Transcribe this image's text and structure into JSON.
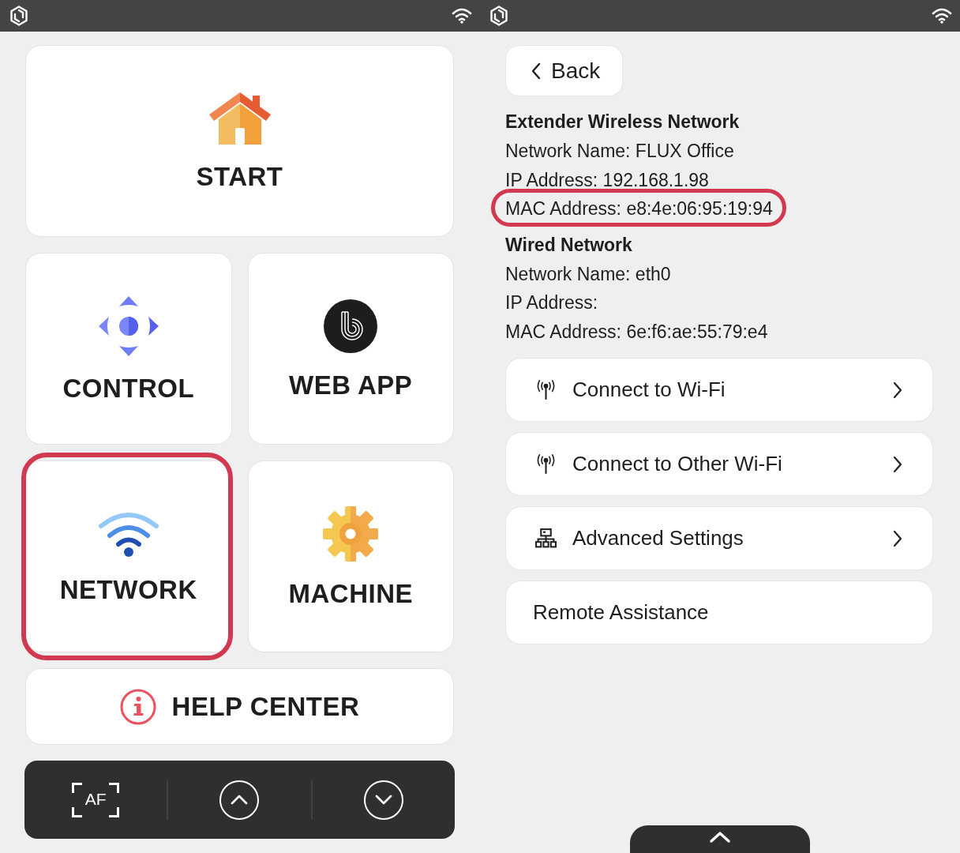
{
  "home_screen": {
    "tiles": [
      {
        "kind": "start",
        "label": "START",
        "highlighted": false
      },
      {
        "kind": "control",
        "label": "CONTROL",
        "highlighted": false
      },
      {
        "kind": "web_app",
        "label": "WEB APP",
        "highlighted": false
      },
      {
        "kind": "network",
        "label": "NETWORK",
        "highlighted": true
      },
      {
        "kind": "machine",
        "label": "MACHINE",
        "highlighted": false
      }
    ],
    "help_button": {
      "label": "HELP CENTER"
    },
    "toolbar": {
      "buttons": [
        {
          "kind": "autofocus",
          "label": "AF"
        },
        {
          "kind": "scroll_up"
        },
        {
          "kind": "scroll_down"
        }
      ]
    }
  },
  "network_screen": {
    "back_button": {
      "label": "Back"
    },
    "sections": [
      {
        "title": "Extender Wireless Network",
        "lines": [
          {
            "text": "Network Name: FLUX Office",
            "highlighted": false
          },
          {
            "text": "IP Address: 192.168.1.98",
            "highlighted": false
          },
          {
            "text": "MAC Address: e8:4e:06:95:19:94",
            "highlighted": true
          }
        ]
      },
      {
        "title": "Wired Network",
        "lines": [
          {
            "text": "Network Name: eth0",
            "highlighted": false
          },
          {
            "text": "IP Address:",
            "highlighted": false
          },
          {
            "text": "MAC Address: 6e:f6:ae:55:79:e4",
            "highlighted": false
          }
        ]
      }
    ],
    "menu": [
      {
        "kind": "wifi",
        "label": "Connect to Wi-Fi"
      },
      {
        "kind": "wifi",
        "label": "Connect to Other Wi-Fi"
      },
      {
        "kind": "network_settings",
        "label": "Advanced Settings"
      },
      {
        "kind": "plain",
        "label": "Remote Assistance"
      }
    ]
  }
}
